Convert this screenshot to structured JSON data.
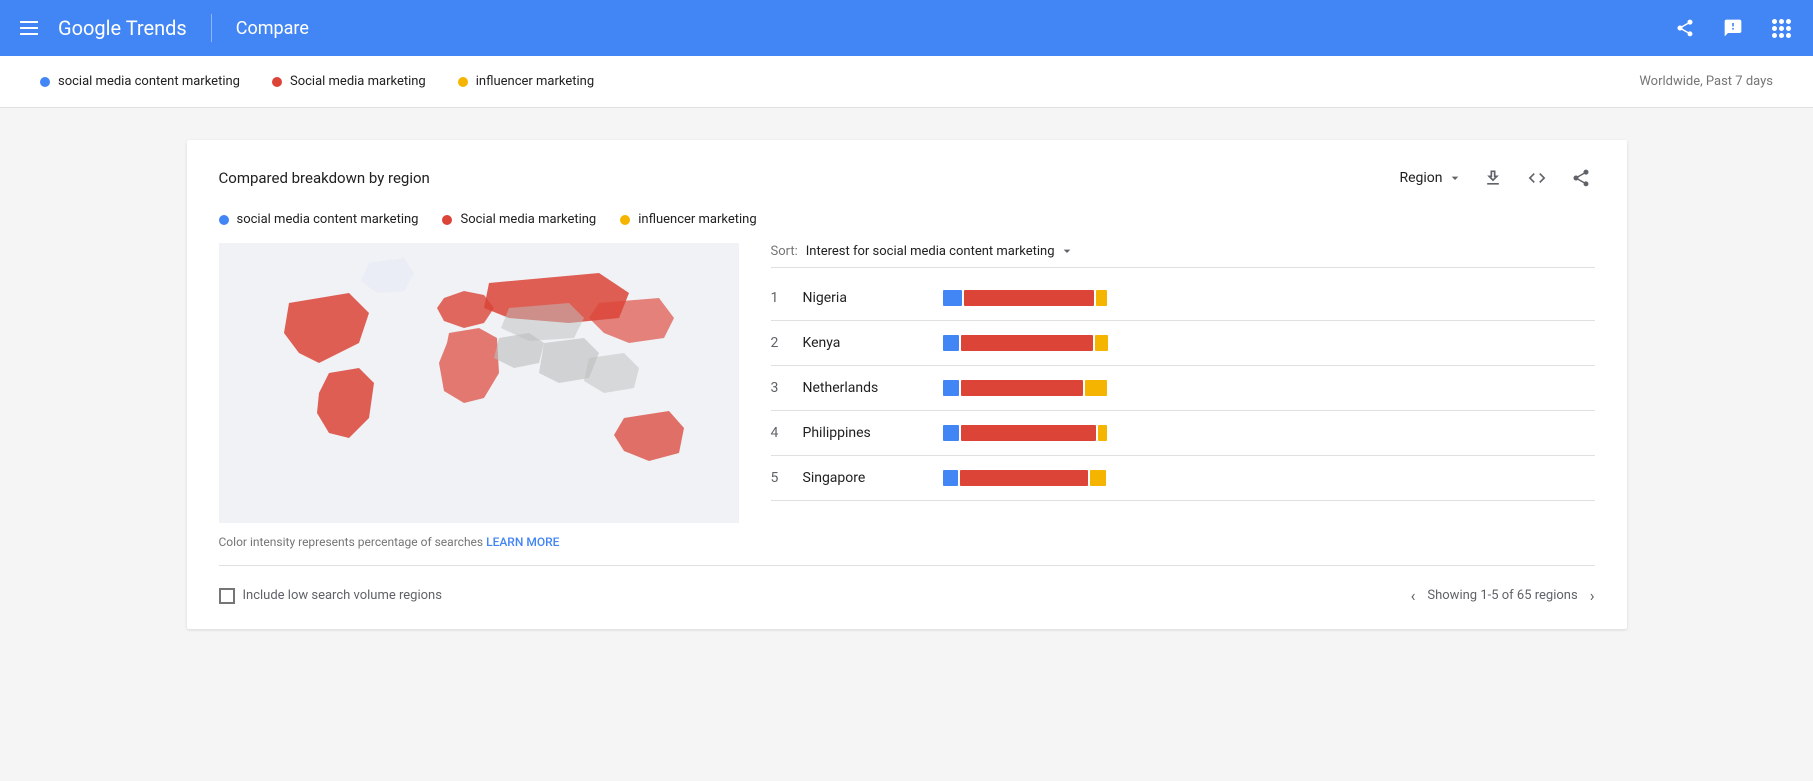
{
  "header": {
    "menu_label": "Menu",
    "logo": "Google Trends",
    "page_title": "Compare",
    "share_label": "Share",
    "feedback_label": "Feedback",
    "apps_label": "Apps"
  },
  "trend_bar": {
    "item1": "social media content marketing",
    "item2": "Social media marketing",
    "item3": "influencer marketing",
    "region_time": "Worldwide, Past 7 days"
  },
  "card": {
    "title": "Compared breakdown by region",
    "region_label": "Region",
    "legend": {
      "item1": "social media content marketing",
      "item2": "Social media marketing",
      "item3": "influencer marketing"
    },
    "sort_label": "Sort:",
    "sort_value": "Interest for social media content marketing",
    "rows": [
      {
        "rank": 1,
        "country": "Nigeria",
        "blue": 18,
        "red": 120,
        "yellow": 10
      },
      {
        "rank": 2,
        "country": "Kenya",
        "blue": 15,
        "red": 125,
        "yellow": 12
      },
      {
        "rank": 3,
        "country": "Netherlands",
        "blue": 14,
        "red": 110,
        "yellow": 20
      },
      {
        "rank": 4,
        "country": "Philippines",
        "blue": 14,
        "red": 120,
        "yellow": 8
      },
      {
        "rank": 5,
        "country": "Singapore",
        "blue": 14,
        "red": 118,
        "yellow": 15
      }
    ],
    "map_note": "Color intensity represents percentage of searches",
    "learn_more": "LEARN MORE",
    "checkbox_label": "Include low search volume regions",
    "pagination_text": "Showing 1-5 of 65 regions",
    "colors": {
      "blue": "#4285f4",
      "red": "#db4437",
      "yellow": "#f4b400",
      "map_highlight": "#db4437",
      "map_bg": "#e8eaf6"
    }
  }
}
